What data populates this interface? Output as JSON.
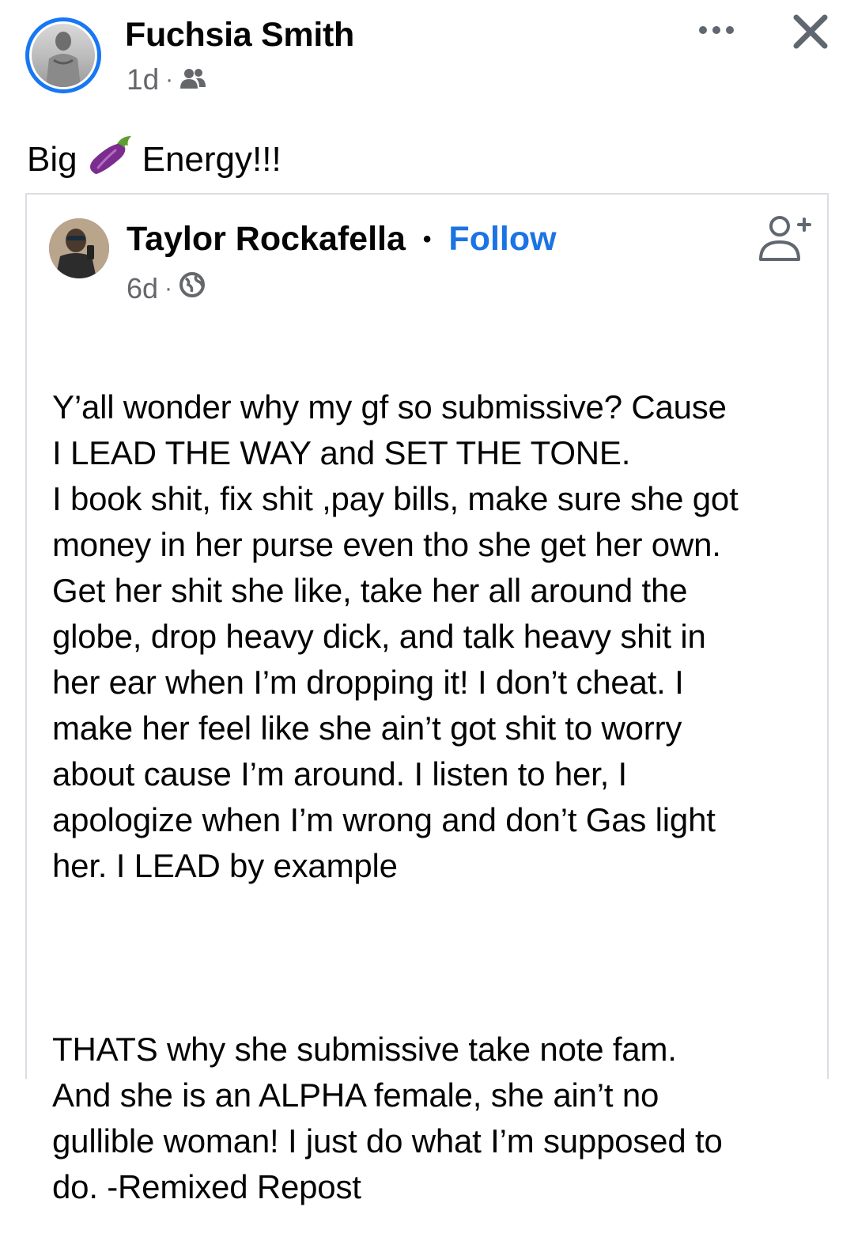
{
  "header": {
    "author_name": "Fuchsia Smith",
    "timestamp": "1d",
    "separator": "·",
    "audience_icon": "friends-icon",
    "more_icon": "more-horizontal-icon",
    "close_icon": "close-icon"
  },
  "post": {
    "caption_before": "Big",
    "caption_emoji": "eggplant-emoji",
    "caption_after": "Energy!!!"
  },
  "shared_post": {
    "author_name": "Taylor Rockafella",
    "name_separator": "•",
    "follow_label": "Follow",
    "timestamp": "6d",
    "separator": "·",
    "audience_icon": "globe-icon",
    "add_friend_icon": "add-friend-icon",
    "paragraph_1": "Y’all wonder why my gf so submissive? Cause\nI LEAD THE WAY and SET THE TONE.\nI book shit, fix shit ,pay bills, make sure she got\nmoney in her purse even tho she get her own.\nGet her shit she like, take her all around the\nglobe, drop heavy dick, and talk heavy shit in\nher ear when I’m dropping it! I don’t cheat. I\nmake her feel like she ain’t got shit to worry\nabout cause I’m around. I listen to her, I\napologize when I’m wrong and don’t Gas light\nher. I LEAD by example",
    "paragraph_2": "THATS why she submissive take note fam.\nAnd she is an ALPHA female,  she ain’t no\ngullible woman! I just do what I’m supposed to\ndo. -Remixed Repost"
  },
  "colors": {
    "accent": "#1877f2",
    "link": "#1b74e4",
    "secondary_text": "#65676b",
    "border": "#dadde1"
  }
}
